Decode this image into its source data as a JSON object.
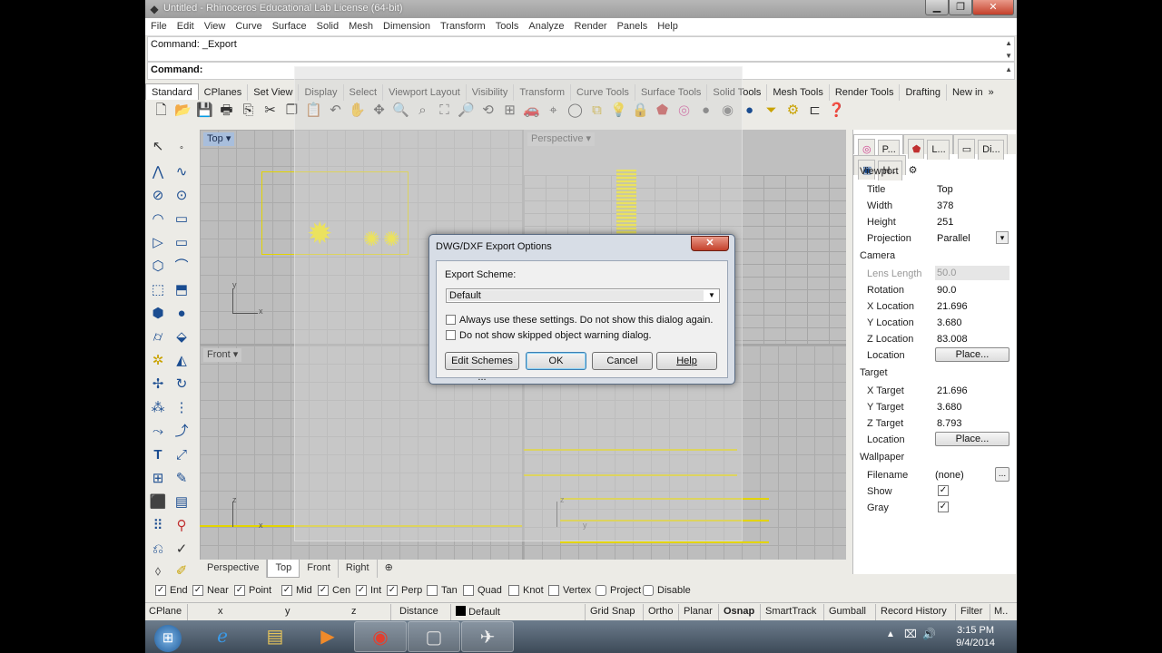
{
  "window": {
    "title": "Untitled - Rhinoceros Educational Lab License (64-bit)",
    "min": "▁",
    "max": "❐",
    "close": "✕"
  },
  "menu": [
    "File",
    "Edit",
    "View",
    "Curve",
    "Surface",
    "Solid",
    "Mesh",
    "Dimension",
    "Transform",
    "Tools",
    "Analyze",
    "Render",
    "Panels",
    "Help"
  ],
  "command": {
    "history": "Command: _Export",
    "prompt": "Command:"
  },
  "toolbar_tabs": [
    "Standard",
    "CPlanes",
    "Set View",
    "Display",
    "Select",
    "Viewport Layout",
    "Visibility",
    "Transform",
    "Curve Tools",
    "Surface Tools",
    "Solid Tools",
    "Mesh Tools",
    "Render Tools",
    "Drafting",
    "New in"
  ],
  "toolbar_tabs_more": "»",
  "toolbar_icons": [
    "new-icon",
    "open-icon",
    "save-icon",
    "print-icon",
    "import-icon",
    "cut-icon",
    "copy-icon",
    "paste-icon",
    "undo-icon",
    "pan-icon",
    "move-view-icon",
    "zoom-icon",
    "zoom-window-icon",
    "zoom-extents-icon",
    "zoom-selected-icon",
    "rotate-view-icon",
    "four-view-icon",
    "car-icon",
    "osnap-icon",
    "circle-icon",
    "layers-icon",
    "light-icon",
    "lock-icon",
    "material-icon",
    "color-wheel-icon",
    "sphere-icon",
    "render-sphere-icon",
    "blue-sphere-icon",
    "filter-icon",
    "gear-icon",
    "dimension-icon",
    "help-icon"
  ],
  "viewports": {
    "top": {
      "label": "Top",
      "axis_y": "y",
      "axis_x": "x"
    },
    "perspective": {
      "label": "Perspective"
    },
    "front": {
      "label": "Front",
      "axis_z": "z",
      "axis_x": "x"
    },
    "right": {
      "axis_z": "z",
      "axis_y": "y"
    }
  },
  "dialog": {
    "title": "DWG/DXF Export Options",
    "close": "✕",
    "scheme_label": "Export Scheme:",
    "scheme_value": "Default",
    "check1": "Always use these settings. Do not show this dialog again.",
    "check2": "Do not show skipped object warning dialog.",
    "btn_edit": "Edit Schemes ...",
    "btn_ok": "OK",
    "btn_cancel": "Cancel",
    "btn_help": "Help"
  },
  "panel": {
    "tabs": [
      "P...",
      "L...",
      "Di...",
      "H..."
    ],
    "viewport_header": "Viewport",
    "rows_viewport": [
      {
        "k": "Title",
        "v": "Top"
      },
      {
        "k": "Width",
        "v": "378"
      },
      {
        "k": "Height",
        "v": "251"
      },
      {
        "k": "Projection",
        "v": "Parallel"
      }
    ],
    "camera_header": "Camera",
    "rows_camera": [
      {
        "k": "Lens Length",
        "v": "50.0"
      },
      {
        "k": "Rotation",
        "v": "90.0"
      },
      {
        "k": "X Location",
        "v": "21.696"
      },
      {
        "k": "Y Location",
        "v": "3.680"
      },
      {
        "k": "Z Location",
        "v": "83.008"
      },
      {
        "k": "Location",
        "v": "Place..."
      }
    ],
    "target_header": "Target",
    "rows_target": [
      {
        "k": "X Target",
        "v": "21.696"
      },
      {
        "k": "Y Target",
        "v": "3.680"
      },
      {
        "k": "Z Target",
        "v": "8.793"
      },
      {
        "k": "Location",
        "v": "Place..."
      }
    ],
    "wallpaper_header": "Wallpaper",
    "rows_wallpaper": [
      {
        "k": "Filename",
        "v": "(none)"
      },
      {
        "k": "Show",
        "v": "✓"
      },
      {
        "k": "Gray",
        "v": "✓"
      }
    ],
    "browse": "...",
    "dropdown_arrow": "▾"
  },
  "viewport_tabs": [
    "Perspective",
    "Top",
    "Front",
    "Right",
    "⊕"
  ],
  "osnaps": [
    {
      "label": "End",
      "checked": true
    },
    {
      "label": "Near",
      "checked": true
    },
    {
      "label": "Point",
      "checked": true
    },
    {
      "label": "Mid",
      "checked": true
    },
    {
      "label": "Cen",
      "checked": true
    },
    {
      "label": "Int",
      "checked": true
    },
    {
      "label": "Perp",
      "checked": true
    },
    {
      "label": "Tan",
      "checked": false
    },
    {
      "label": "Quad",
      "checked": false
    },
    {
      "label": "Knot",
      "checked": false
    },
    {
      "label": "Vertex",
      "checked": false
    },
    {
      "label": "Project",
      "checked": false
    },
    {
      "label": "Disable",
      "checked": false
    }
  ],
  "statusbar": {
    "cplane": "CPlane",
    "x": "x",
    "y": "y",
    "z": "z",
    "distance": "Distance",
    "layer": "Default",
    "grid_snap": "Grid Snap",
    "ortho": "Ortho",
    "planar": "Planar",
    "osnap": "Osnap",
    "smarttrack": "SmartTrack",
    "gumball": "Gumball",
    "record_history": "Record History",
    "filter": "Filter",
    "more": "M.."
  },
  "taskbar": {
    "time": "3:15 PM",
    "date": "9/4/2014"
  }
}
